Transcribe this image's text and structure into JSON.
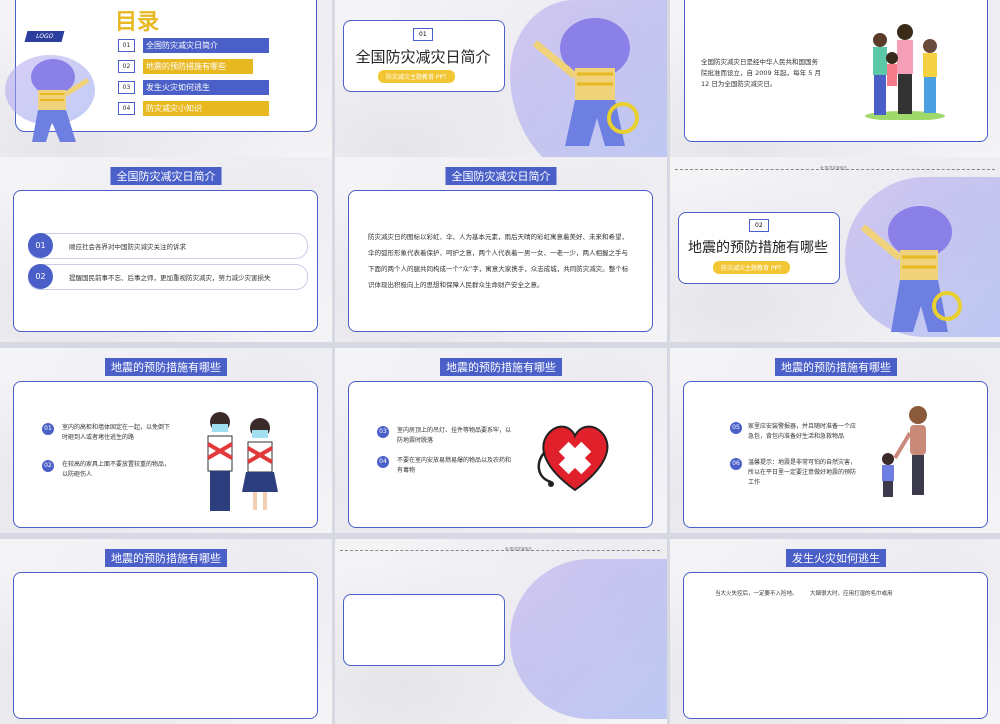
{
  "toc": {
    "title": "目录",
    "logo": "LOGO",
    "items": [
      {
        "num": "01",
        "label": "全国防灾减灾日简介",
        "color": "#4a5fc8"
      },
      {
        "num": "02",
        "label": "地震的预防措施有哪些",
        "color": "#e8b820"
      },
      {
        "num": "03",
        "label": "发生火灾如何逃生",
        "color": "#4a5fc8"
      },
      {
        "num": "04",
        "label": "防灾减灾小知识",
        "color": "#e8b820"
      }
    ]
  },
  "section1": {
    "num": "01",
    "title": "全国防灾减灾日简介",
    "subtitle": "防灾减灾主题教育 PPT"
  },
  "slide3": {
    "text": "全国防灾减灾日是经中华人民共和国国务院批准而设立，自 2009 年起，每年 5 月 12 日为全国防灾减灾日。"
  },
  "slide4": {
    "tag": "全国防灾减灾日简介",
    "items": [
      {
        "num": "01",
        "text": "顺应社会各界对中国防灾减灾关注的诉求"
      },
      {
        "num": "02",
        "text": "提醒国民前事不忘、后事之师，更加重视防灾减灾，努力减少灾害损失"
      }
    ]
  },
  "slide5": {
    "tag": "全国防灾减灾日简介",
    "text": "防灾减灾日的图标以彩虹、伞、人为基本元素，雨后天晴的彩虹寓意着美好、未来和希望，伞的弧形形象代表着保护、呵护之意，两个人代表着一男一女、一老一少，两人相握之手与下面的两个人的腿共同构成一个“众”字，寓意大家携手，众志成城，共同防灾减灾。整个标识体现出积极向上的思想和保障人民群众生命财产安全之意。"
  },
  "section2": {
    "header": "全 国 防灾宣传日",
    "num": "02",
    "title": "地震的预防措施有哪些",
    "subtitle": "防灾减灾主题教育 PPT"
  },
  "slide7": {
    "tag": "地震的预防措施有哪些",
    "items": [
      {
        "num": "01",
        "text": "室内的高柜和墙体固定在一起，以免倒下时砸到人或者堵住逃生的路"
      },
      {
        "num": "02",
        "text": "在较高的家具上面不要放置较重的物品，以防砸伤人"
      }
    ]
  },
  "slide8": {
    "tag": "地震的预防措施有哪些",
    "items": [
      {
        "num": "03",
        "text": "室内房顶上的吊灯、挂件等物品要系牢，以防地震时脱落"
      },
      {
        "num": "04",
        "text": "不要在室内安放易燃易爆的物品以及农药和有毒物"
      }
    ]
  },
  "slide9": {
    "tag": "地震的预防措施有哪些",
    "items": [
      {
        "num": "05",
        "text": "家里应安装警报器，并且随时准备一个应急包，背包内准备好生活和急救物品"
      },
      {
        "num": "06",
        "text": "温馨提示：地震是非常可怕的自然灾害，所以在平日里一定要注意做好地震的预防工作"
      }
    ]
  },
  "slide10": {
    "tag": "地震的预防措施有哪些"
  },
  "slide11": {
    "header": "全 国 防灾宣传日"
  },
  "slide12": {
    "tag": "发生火灾如何逃生",
    "text1": "当大火失控后，一定要不入险地。",
    "text2": "大烟很大时，应用打湿的毛巾或用"
  }
}
